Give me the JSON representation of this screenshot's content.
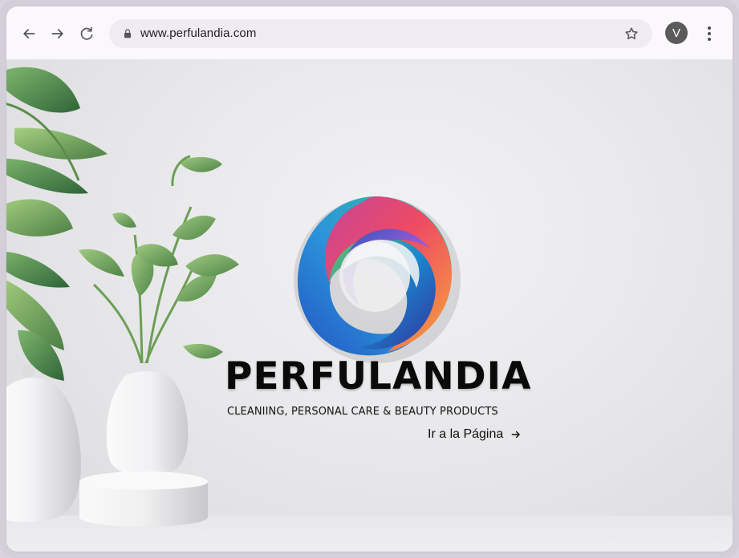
{
  "browser": {
    "url": "www.perfulandia.com",
    "profile_initial": "V"
  },
  "page": {
    "brand_name": "PERFULANDIA",
    "tagline": "CLEANIING, PERSONAL CARE & BEAUTY PRODUCTS",
    "cta_label": "Ir a la Página"
  },
  "icons": {
    "back": "arrow-left-icon",
    "forward": "arrow-right-icon",
    "reload": "reload-icon",
    "lock": "lock-icon",
    "star": "star-icon",
    "menu": "more-vertical-icon",
    "cta_arrow": "arrow-right-icon"
  },
  "colors": {
    "browser_bg": "#fbf8fd",
    "omnibox_bg": "#f0ebf3",
    "brand_text": "#0a0a0a",
    "avatar_bg": "#5b5b5b"
  }
}
